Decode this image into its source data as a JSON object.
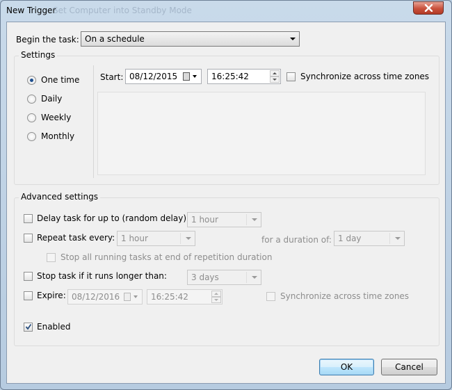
{
  "window": {
    "title": "New Trigger",
    "ghost_title": "Set Computer into Standby Mode"
  },
  "begin": {
    "label": "Begin the task:",
    "value": "On a schedule"
  },
  "settings": {
    "legend": "Settings",
    "options": [
      "One time",
      "Daily",
      "Weekly",
      "Monthly"
    ],
    "selected": "One time",
    "start_label": "Start:",
    "start_date": "08/12/2015",
    "start_time": "16:25:42",
    "sync_label": "Synchronize across time zones"
  },
  "advanced": {
    "legend": "Advanced settings",
    "delay_label": "Delay task for up to (random delay):",
    "delay_value": "1 hour",
    "repeat_label": "Repeat task every:",
    "repeat_value": "1 hour",
    "duration_label": "for a duration of:",
    "duration_value": "1 day",
    "stop_repetition_label": "Stop all running tasks at end of repetition duration",
    "stop_label": "Stop task if it runs longer than:",
    "stop_value": "3 days",
    "expire_label": "Expire:",
    "expire_date": "08/12/2016",
    "expire_time": "16:25:42",
    "expire_sync_label": "Synchronize across time zones",
    "enabled_label": "Enabled",
    "enabled": true
  },
  "buttons": {
    "ok": "OK",
    "cancel": "Cancel"
  }
}
